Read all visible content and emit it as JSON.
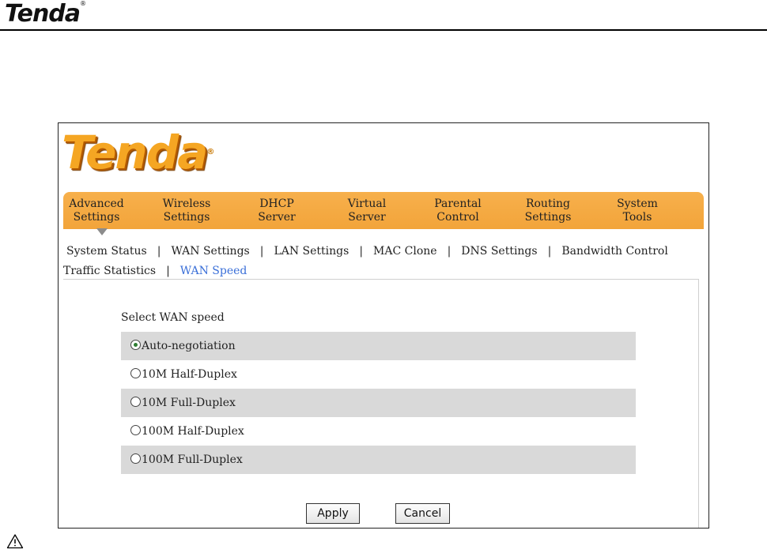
{
  "doc_header": {
    "logo": "Tenda",
    "reg": "®"
  },
  "app": {
    "logo": "Tenda",
    "reg": "®"
  },
  "menu": [
    {
      "line1": "Advanced",
      "line2": "Settings"
    },
    {
      "line1": "Wireless",
      "line2": "Settings"
    },
    {
      "line1": "DHCP",
      "line2": "Server"
    },
    {
      "line1": "Virtual",
      "line2": "Server"
    },
    {
      "line1": "Parental",
      "line2": "Control"
    },
    {
      "line1": "Routing",
      "line2": "Settings"
    },
    {
      "line1": "System",
      "line2": "Tools"
    }
  ],
  "submenu": {
    "separator": "|",
    "items": [
      "System Status",
      "WAN Settings",
      "LAN Settings",
      "MAC Clone",
      "DNS Settings",
      "Bandwidth Control",
      "Traffic Statistics",
      "WAN Speed"
    ]
  },
  "form": {
    "label": "Select WAN speed",
    "options": [
      "Auto-negotiation",
      "10M Half-Duplex",
      "10M Full-Duplex",
      "100M Half-Duplex",
      "100M Full-Duplex"
    ],
    "selected": "Auto-negotiation"
  },
  "buttons": {
    "apply": "Apply",
    "cancel": "Cancel"
  },
  "colors": {
    "menu_bar": "#f2a43a",
    "active_link": "#3a6fd8",
    "row_shade": "#d9d9d9"
  },
  "icons": {
    "warning": "warning-triangle-icon"
  }
}
